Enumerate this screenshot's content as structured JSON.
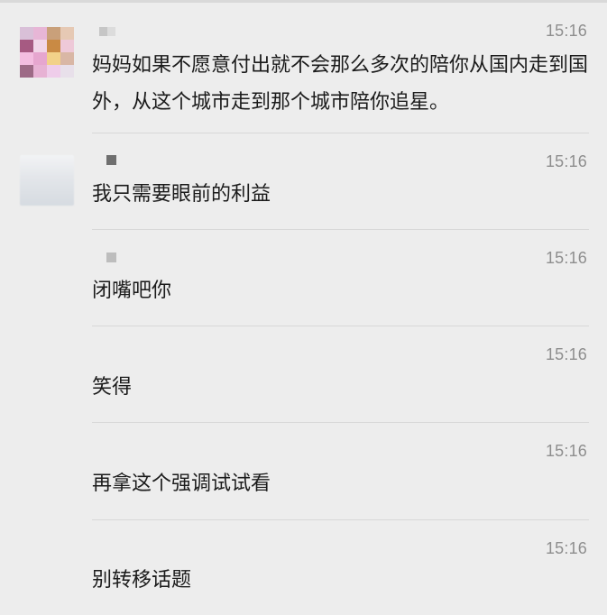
{
  "messages": [
    {
      "time": "15:16",
      "text": "妈妈如果不愿意付出就不会那么多次的陪你从国内走到国外，从这个城市走到那个城市陪你追星。"
    },
    {
      "time": "15:16",
      "text": "我只需要眼前的利益"
    },
    {
      "time": "15:16",
      "text": "闭嘴吧你"
    },
    {
      "time": "15:16",
      "text": "笑得"
    },
    {
      "time": "15:16",
      "text": "再拿这个强调试试看"
    },
    {
      "time": "15:16",
      "text": "别转移话题"
    }
  ]
}
